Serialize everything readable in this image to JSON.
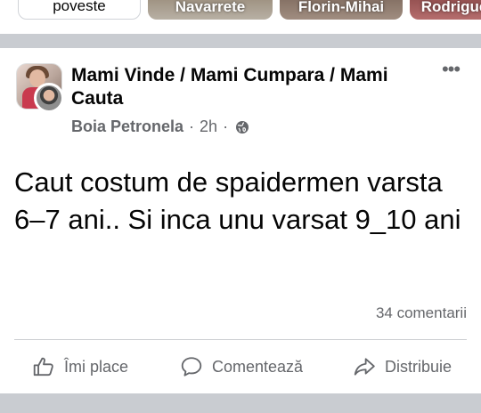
{
  "stories": [
    {
      "label": "poveste"
    },
    {
      "label": "Navarrete"
    },
    {
      "label": "Florin-Mihai"
    },
    {
      "label": "Rodrigue"
    }
  ],
  "post": {
    "group_name": "Mami Vinde / Mami Cumpara / Mami Cauta",
    "author": "Boia Petronela",
    "time": "2h",
    "separator": "·",
    "privacy_icon": "globe-icon",
    "more_icon": "more-options-icon",
    "more_glyph": "•••",
    "text": "Caut costum de spaidermen varsta 6–7 ani.. Si inca unu varsat 9_10 ani",
    "comments_count": "34 comentarii",
    "actions": {
      "like": "Îmi place",
      "comment": "Comentează",
      "share": "Distribuie"
    }
  },
  "colors": {
    "secondary_text": "#65676b",
    "separator_bar": "#c9ccd1",
    "primary_text": "#050505"
  }
}
